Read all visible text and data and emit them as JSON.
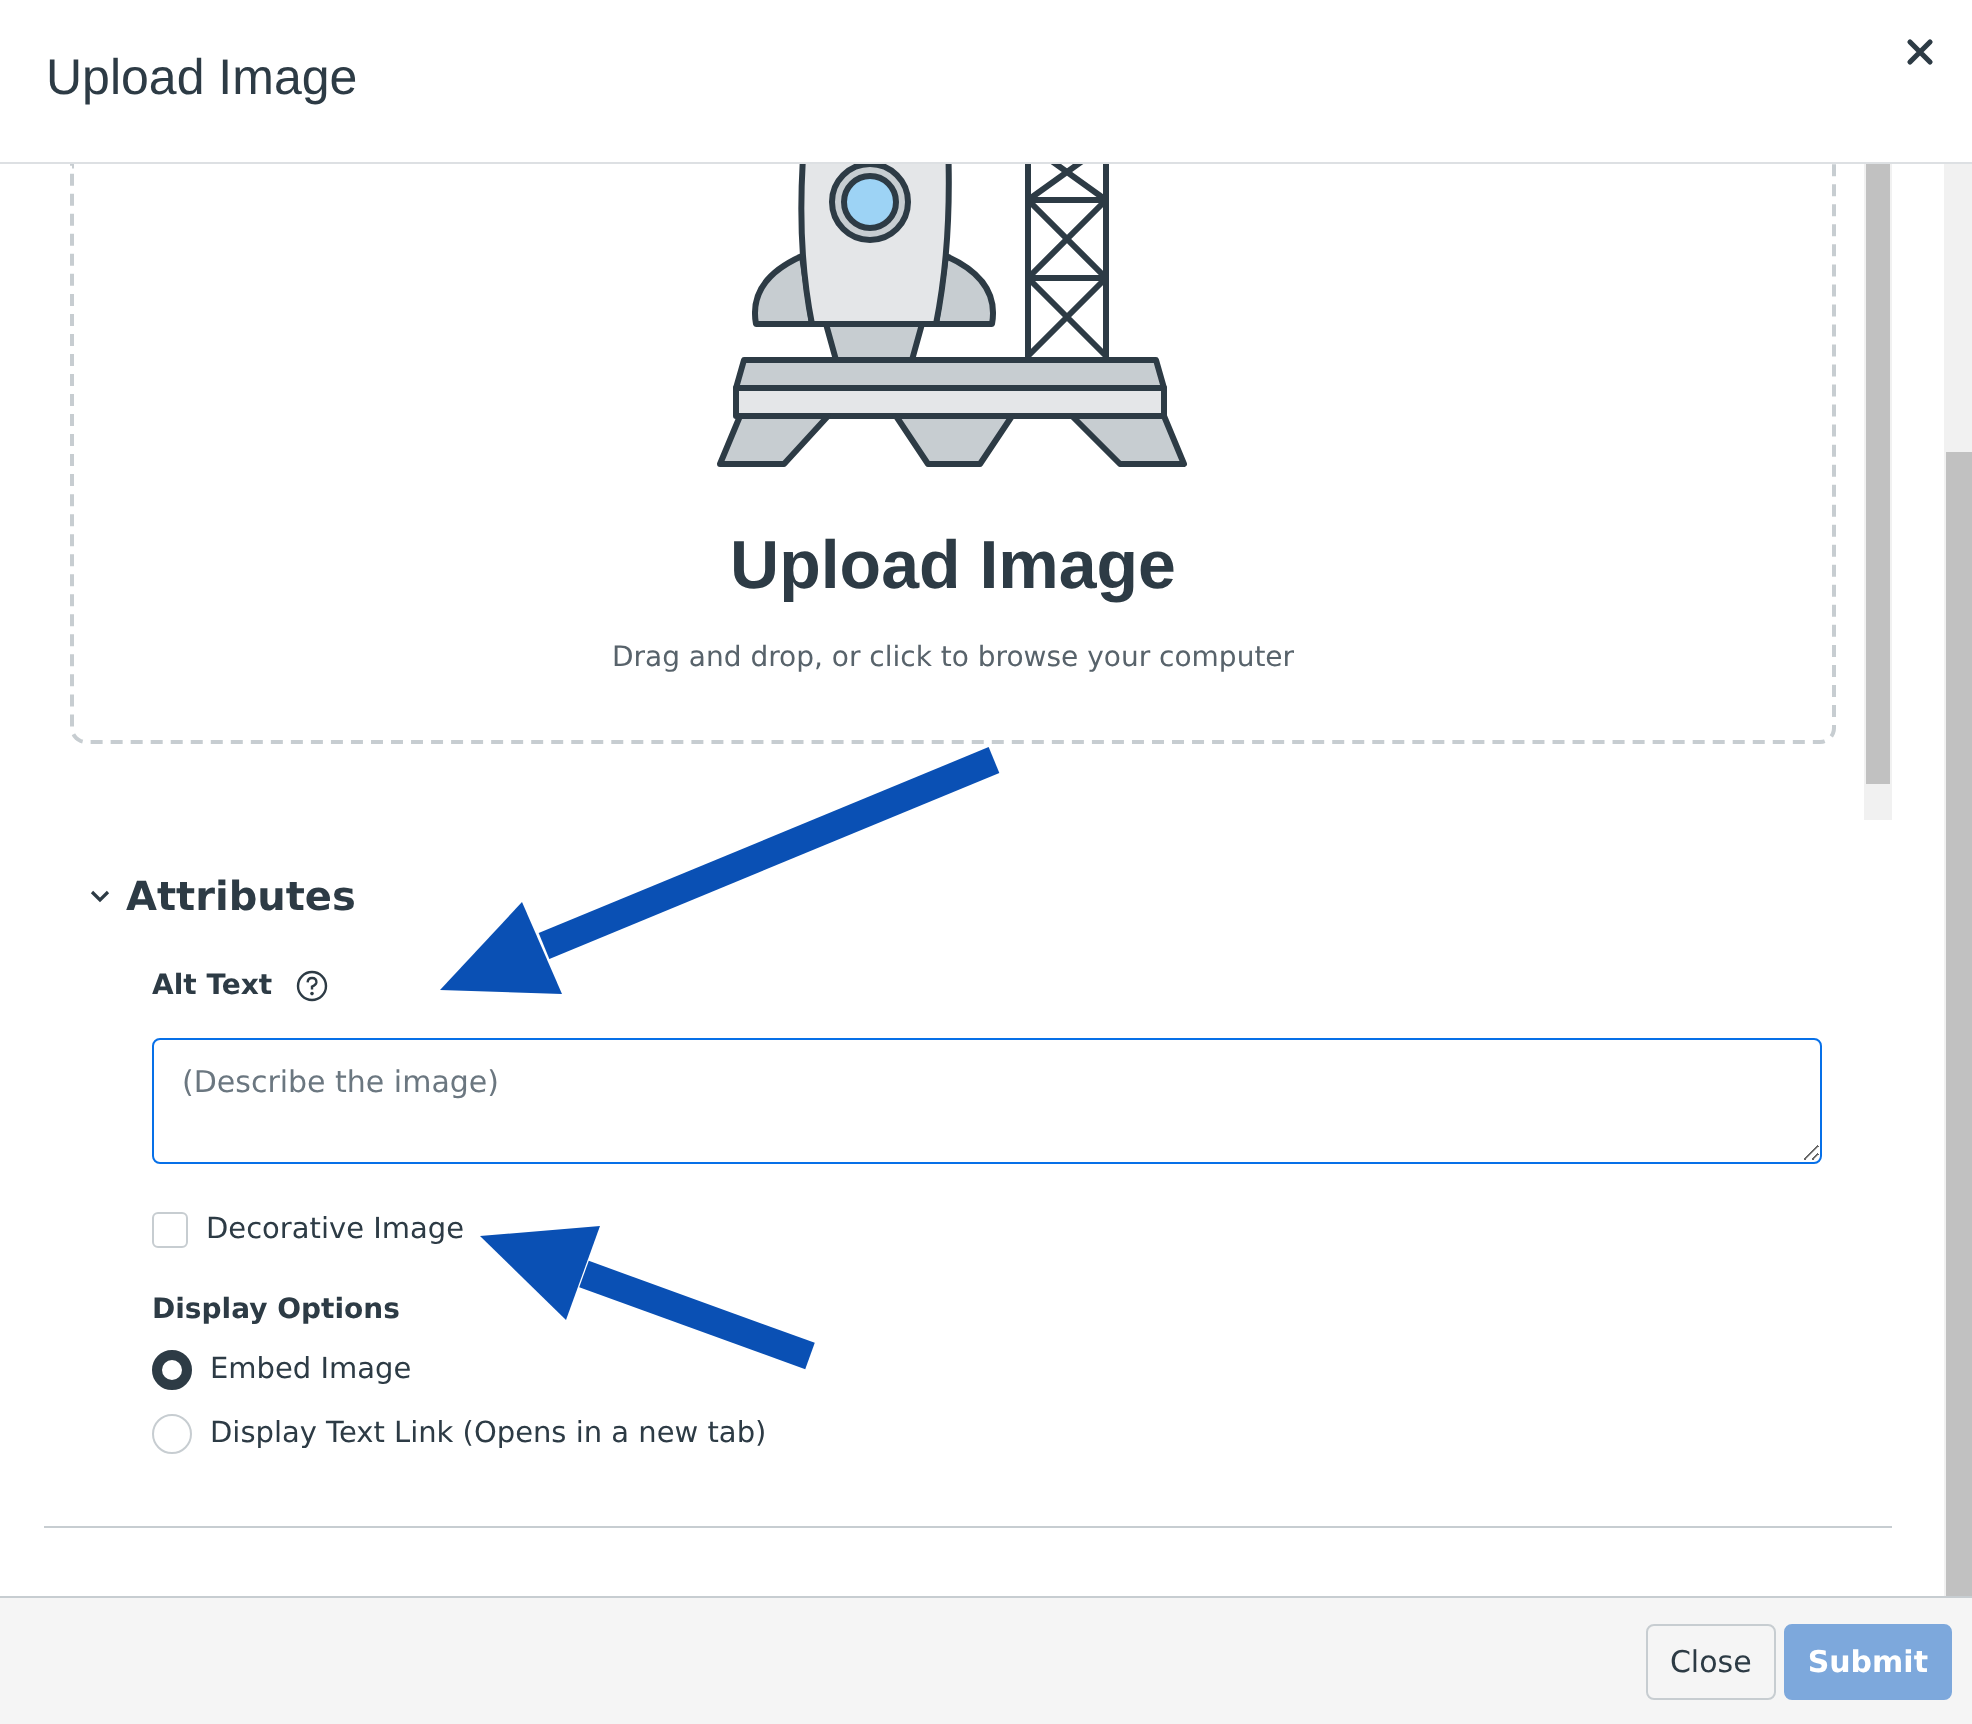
{
  "dialog": {
    "title": "Upload Image"
  },
  "dropzone": {
    "heading": "Upload Image",
    "hint": "Drag and drop, or click to browse your computer"
  },
  "attributes": {
    "heading": "Attributes",
    "expanded": true,
    "alt_text": {
      "label": "Alt Text",
      "placeholder": "(Describe the image)"
    },
    "decorative": {
      "label": "Decorative Image",
      "checked": false
    },
    "display_options": {
      "label": "Display Options",
      "options": [
        {
          "label": "Embed Image",
          "selected": true
        },
        {
          "label": "Display Text Link (Opens in a new tab)",
          "selected": false
        }
      ]
    }
  },
  "footer": {
    "buttons": [
      {
        "label": "Close",
        "kind": "secondary",
        "disabled": false
      },
      {
        "label": "Submit",
        "kind": "primary",
        "disabled": true
      }
    ]
  }
}
